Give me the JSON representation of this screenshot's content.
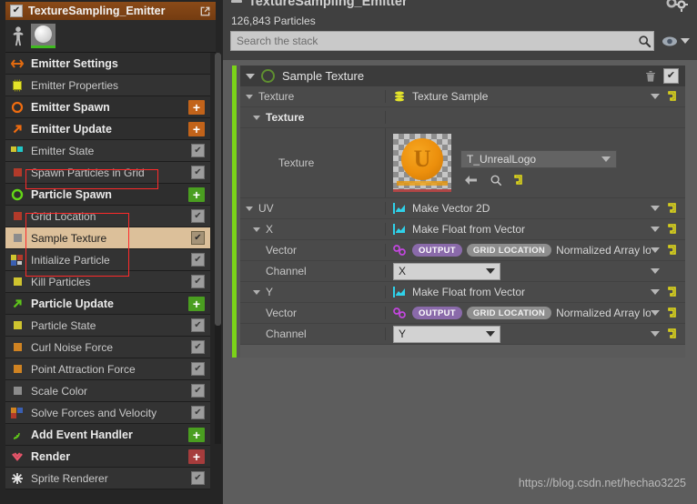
{
  "emitter": {
    "title": "TextureSampling_Emitter",
    "checkbox_glyph": "✔",
    "popout_icon": "popout-icon",
    "person_icon": "person-icon",
    "thumbnail_icon": "sphere-thumbnail"
  },
  "stack": {
    "items": [
      {
        "kind": "group",
        "label": "Emitter Settings",
        "icon": "emitter-settings-icon",
        "action": "none",
        "swatch": ""
      },
      {
        "kind": "module",
        "label": "Emitter Properties",
        "icon": "gpu-icon",
        "action": "none",
        "swatch": ""
      },
      {
        "kind": "group",
        "label": "Emitter Spawn",
        "icon": "circle-orange-icon",
        "action": "plus-orange",
        "swatch": ""
      },
      {
        "kind": "group",
        "label": "Emitter Update",
        "icon": "arrow-orange-icon",
        "action": "plus-orange",
        "swatch": ""
      },
      {
        "kind": "module",
        "label": "Emitter State",
        "icon": "multi-swatch-icon",
        "action": "check",
        "swatch": "multi"
      },
      {
        "kind": "module",
        "label": "Spawn Particles in Grid",
        "icon": "swatch-red-icon",
        "action": "check",
        "swatch": "red"
      },
      {
        "kind": "group",
        "label": "Particle Spawn",
        "icon": "circle-green-icon",
        "action": "plus-green",
        "swatch": ""
      },
      {
        "kind": "module",
        "label": "Grid Location",
        "icon": "swatch-red-icon",
        "action": "check",
        "swatch": "red"
      },
      {
        "kind": "module",
        "label": "Sample Texture",
        "icon": "swatch-grey-icon",
        "action": "check",
        "swatch": "grey",
        "selected": true
      },
      {
        "kind": "module",
        "label": "Initialize Particle",
        "icon": "multi-swatch-icon",
        "action": "check",
        "swatch": "multi2"
      },
      {
        "kind": "module",
        "label": "Kill Particles",
        "icon": "swatch-yellow-icon",
        "action": "check",
        "swatch": "yellow"
      },
      {
        "kind": "group",
        "label": "Particle Update",
        "icon": "arrow-green-icon",
        "action": "plus-green",
        "swatch": ""
      },
      {
        "kind": "module",
        "label": "Particle State",
        "icon": "swatch-yellow-icon",
        "action": "check",
        "swatch": "yellow"
      },
      {
        "kind": "module",
        "label": "Curl Noise Force",
        "icon": "swatch-orange-icon",
        "action": "check",
        "swatch": "orange"
      },
      {
        "kind": "module",
        "label": "Point Attraction Force",
        "icon": "swatch-orange-icon",
        "action": "check",
        "swatch": "orange"
      },
      {
        "kind": "module",
        "label": "Scale Color",
        "icon": "swatch-grey-icon",
        "action": "check",
        "swatch": "grey"
      },
      {
        "kind": "module",
        "label": "Solve Forces and Velocity",
        "icon": "multi-swatch-icon",
        "action": "check",
        "swatch": "multi3"
      },
      {
        "kind": "group",
        "label": "Add Event Handler",
        "icon": "event-green-icon",
        "action": "plus-green",
        "swatch": ""
      },
      {
        "kind": "group",
        "label": "Render",
        "icon": "render-red-icon",
        "action": "plus-red",
        "swatch": ""
      },
      {
        "kind": "module",
        "label": "Sprite Renderer",
        "icon": "sprite-star-icon",
        "action": "check",
        "swatch": ""
      }
    ],
    "check_glyph": "✔"
  },
  "header": {
    "title": "TextureSampling_Emitter",
    "particle_count": "126,843 Particles",
    "gear_icon": "gears-icon"
  },
  "search": {
    "value": "",
    "placeholder": "Search the stack",
    "search_icon": "search-icon",
    "eye_icon": "eye-icon",
    "chevron_icon": "chevron-down-icon"
  },
  "module_card": {
    "title": "Sample Texture",
    "accent_color": "#7bd319",
    "trash_icon": "trash-icon",
    "enabled_glyph": "✔",
    "rows": [
      {
        "name": "Texture",
        "indent": 0,
        "bold": false,
        "type": "node",
        "value": "Texture Sample",
        "vicon": "data-interface-icon"
      },
      {
        "name": "Texture",
        "indent": 1,
        "bold": true,
        "type": "header",
        "value": "",
        "vicon": ""
      },
      {
        "name": "Texture",
        "indent": 2,
        "bold": false,
        "type": "asset",
        "value": "T_UnrealLogo",
        "vicon": "texture-thumbnail"
      },
      {
        "name": "UV",
        "indent": 0,
        "bold": false,
        "type": "node",
        "value": "Make Vector 2D",
        "vicon": "dynamic-input-icon"
      },
      {
        "name": "X",
        "indent": 1,
        "bold": false,
        "type": "node",
        "value": "Make Float from Vector",
        "vicon": "dynamic-input-icon"
      },
      {
        "name": "Vector",
        "indent": 2,
        "bold": false,
        "type": "link",
        "value": "Normalized Array locat",
        "vicon": "link-icon",
        "pill1": "OUTPUT",
        "pill2": "GRID LOCATION"
      },
      {
        "name": "Channel",
        "indent": 2,
        "bold": false,
        "type": "enum",
        "value": "X",
        "vicon": ""
      },
      {
        "name": "Y",
        "indent": 1,
        "bold": false,
        "type": "node",
        "value": "Make Float from Vector",
        "vicon": "dynamic-input-icon"
      },
      {
        "name": "Vector",
        "indent": 2,
        "bold": false,
        "type": "link",
        "value": "Normalized Array locat",
        "vicon": "link-icon",
        "pill1": "OUTPUT",
        "pill2": "GRID LOCATION"
      },
      {
        "name": "Channel",
        "indent": 2,
        "bold": false,
        "type": "enum",
        "value": "Y",
        "vicon": ""
      }
    ]
  },
  "asset_tools": {
    "back_icon": "browse-back-icon",
    "browse_icon": "find-in-content-browser-icon",
    "reset_icon": "reset-to-default-icon"
  },
  "watermark": {
    "text": "https://blog.csdn.net/hechao3225"
  }
}
